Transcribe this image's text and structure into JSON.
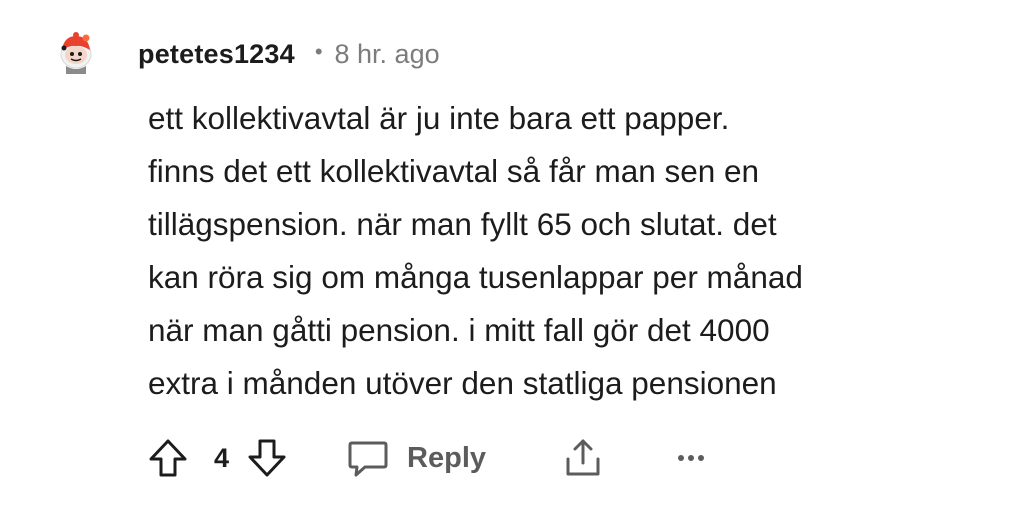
{
  "comment": {
    "username": "petetes1234",
    "separator": "•",
    "timestamp": "8 hr. ago",
    "lines": [
      "ett kollektivavtal är ju inte bara ett papper.",
      "finns det ett kollektivavtal så får man sen en",
      "tillägspension. när man fyllt 65 och slutat. det",
      "kan röra sig om många tusenlappar per månad",
      "när man gåtti pension. i mitt fall gör det 4000",
      "extra i månden utöver den statliga pensionen"
    ]
  },
  "actions": {
    "upvote_icon": "arrow-up-icon",
    "vote_count": "4",
    "downvote_icon": "arrow-down-icon",
    "reply_icon": "speech-bubble-icon",
    "reply_label": "Reply",
    "share_icon": "share-icon",
    "more_icon": "ellipsis-icon"
  },
  "colors": {
    "text": "#1c1c1c",
    "muted": "#7c7c7c",
    "icon": "#1c1c1c",
    "avatar_red": "#e8422f",
    "avatar_skin": "#f3d6c7"
  }
}
